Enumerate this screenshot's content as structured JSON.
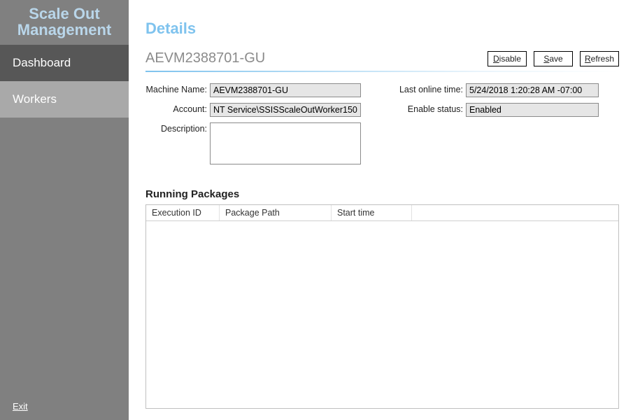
{
  "app_title_line1": "Scale Out",
  "app_title_line2": "Management",
  "nav": {
    "dashboard": "Dashboard",
    "workers": "Workers"
  },
  "footer": {
    "exit": "Exit"
  },
  "page": {
    "title": "Details"
  },
  "header": {
    "worker_name": "AEVM2388701-GU",
    "buttons": {
      "disable_prefix": "D",
      "disable_rest": "isable",
      "save_prefix": "S",
      "save_rest": "ave",
      "refresh_prefix": "R",
      "refresh_rest": "efresh"
    }
  },
  "form": {
    "labels": {
      "machine_name": "Machine Name:",
      "account": "Account:",
      "description": "Description:",
      "last_online": "Last online time:",
      "enable_status": "Enable status:"
    },
    "values": {
      "machine_name": "AEVM2388701-GU",
      "account": "NT Service\\SSISScaleOutWorker150",
      "description": "",
      "last_online": "5/24/2018 1:20:28 AM -07:00",
      "enable_status": "Enabled"
    }
  },
  "running_packages": {
    "title": "Running Packages",
    "columns": [
      "Execution ID",
      "Package Path",
      "Start time"
    ],
    "rows": []
  }
}
